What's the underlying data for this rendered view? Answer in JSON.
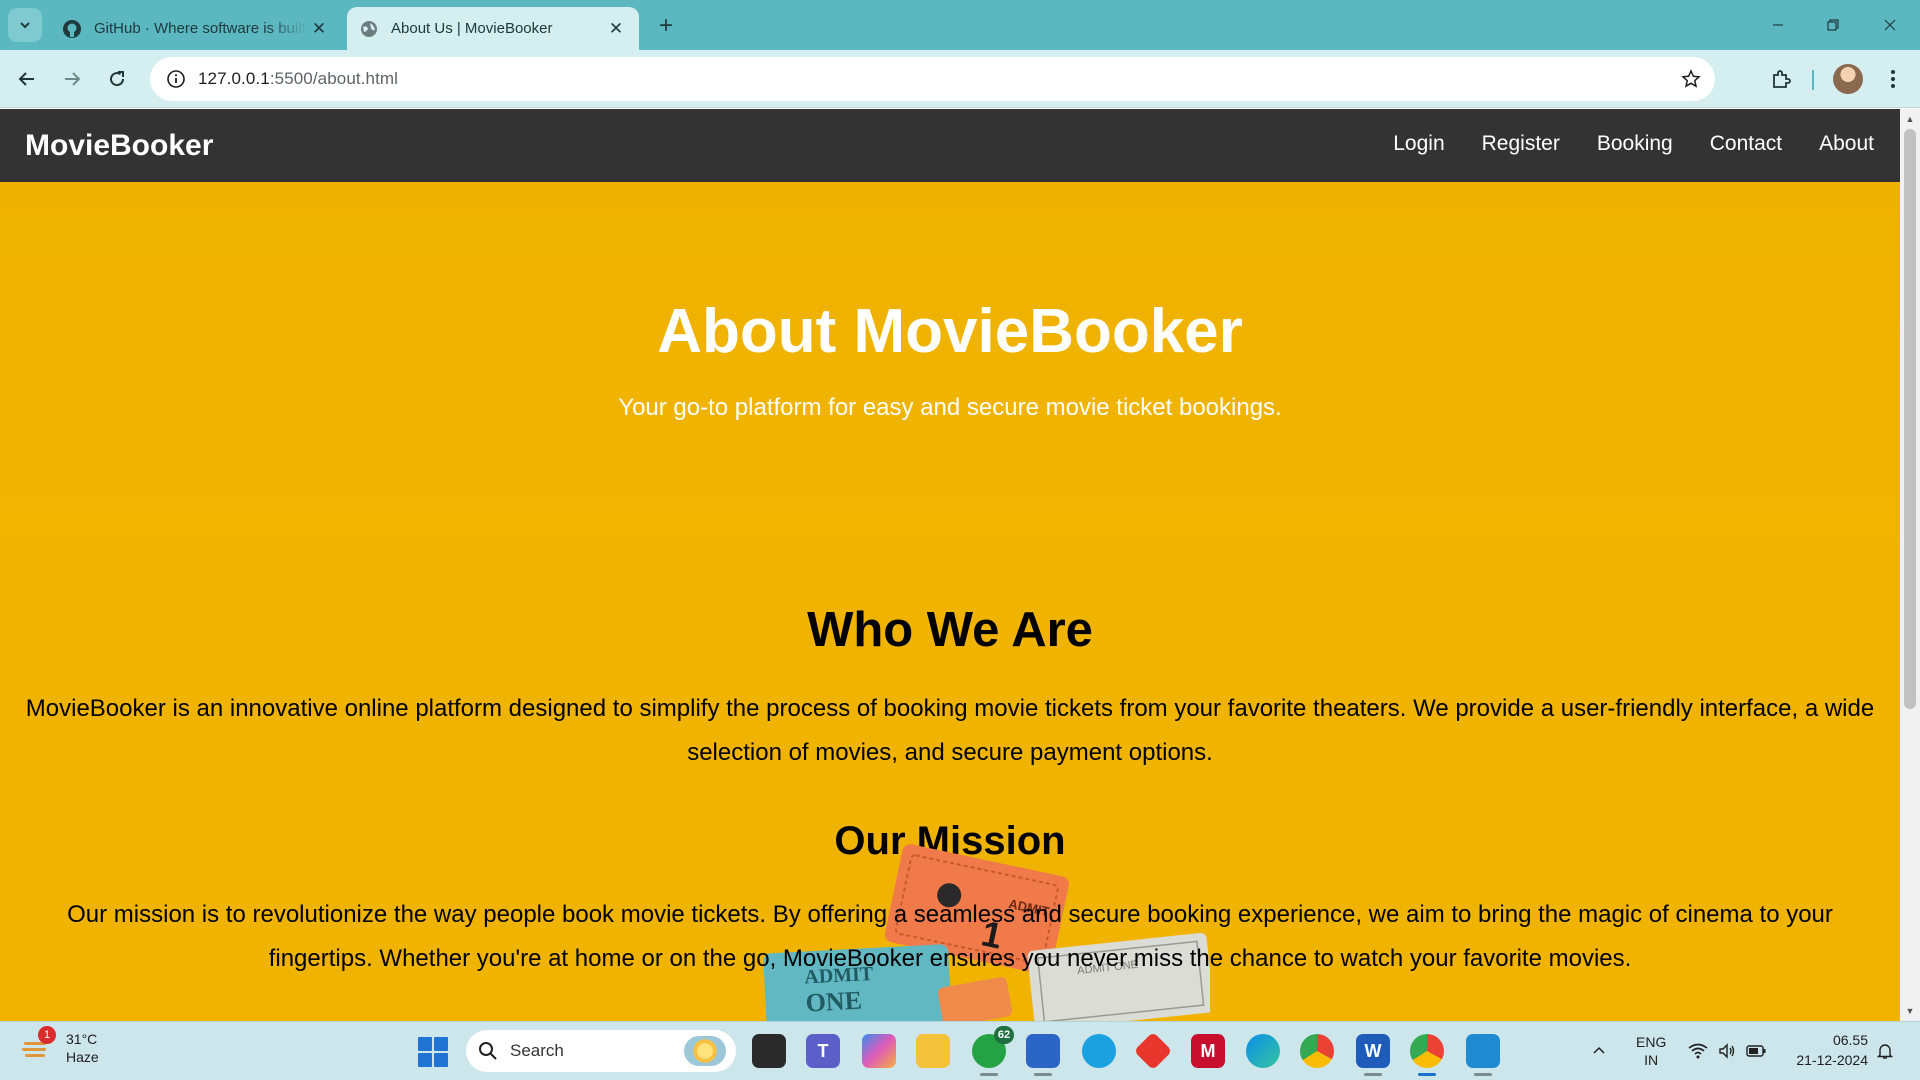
{
  "browser": {
    "tabs": [
      {
        "title": "GitHub · Where software is built",
        "favicon": "github-icon",
        "active": false
      },
      {
        "title": "About Us | MovieBooker",
        "favicon": "globe-icon",
        "active": true
      }
    ],
    "new_tab_label": "+",
    "close_glyph": "✕",
    "url_host": "127.0.0.1",
    "url_path": ":5500/about.html"
  },
  "site": {
    "brand": "MovieBooker",
    "nav": [
      "Login",
      "Register",
      "Booking",
      "Contact",
      "About"
    ],
    "hero": {
      "title": "About MovieBooker",
      "subtitle": "Your go-to platform for easy and secure movie ticket bookings."
    },
    "who": {
      "heading": "Who We Are",
      "text": "MovieBooker is an innovative online platform designed to simplify the process of booking movie tickets from your favorite theaters. We provide a user-friendly interface, a wide selection of movies, and secure payment options."
    },
    "mission": {
      "heading": "Our Mission",
      "text": "Our mission is to revolutionize the way people book movie tickets. By offering a seamless and secure booking experience, we aim to bring the magic of cinema to your fingertips. Whether you're at home or on the go, MovieBooker ensures you never miss the chance to watch your favorite movies."
    },
    "ticket_labels": [
      "ADMIT",
      "ONE",
      "ADMIT ONE",
      "1"
    ],
    "accent_color": "#f0b400",
    "nav_bg": "#333333"
  },
  "taskbar": {
    "weather": {
      "temp": "31°C",
      "condition": "Haze",
      "badge": "1"
    },
    "search_label": "Search",
    "whatsapp_badge": "62",
    "apps": [
      "file-explorer-icon",
      "teams-icon",
      "copilot-icon",
      "folder-icon",
      "whatsapp-icon",
      "store-icon",
      "edge-dev-icon",
      "git-icon",
      "mcafee-icon",
      "edge-icon",
      "chrome-icon",
      "word-icon",
      "chrome-profile-icon",
      "vscode-icon"
    ],
    "lang_top": "ENG",
    "lang_bottom": "IN",
    "time": "06.55",
    "date": "21-12-2024"
  }
}
